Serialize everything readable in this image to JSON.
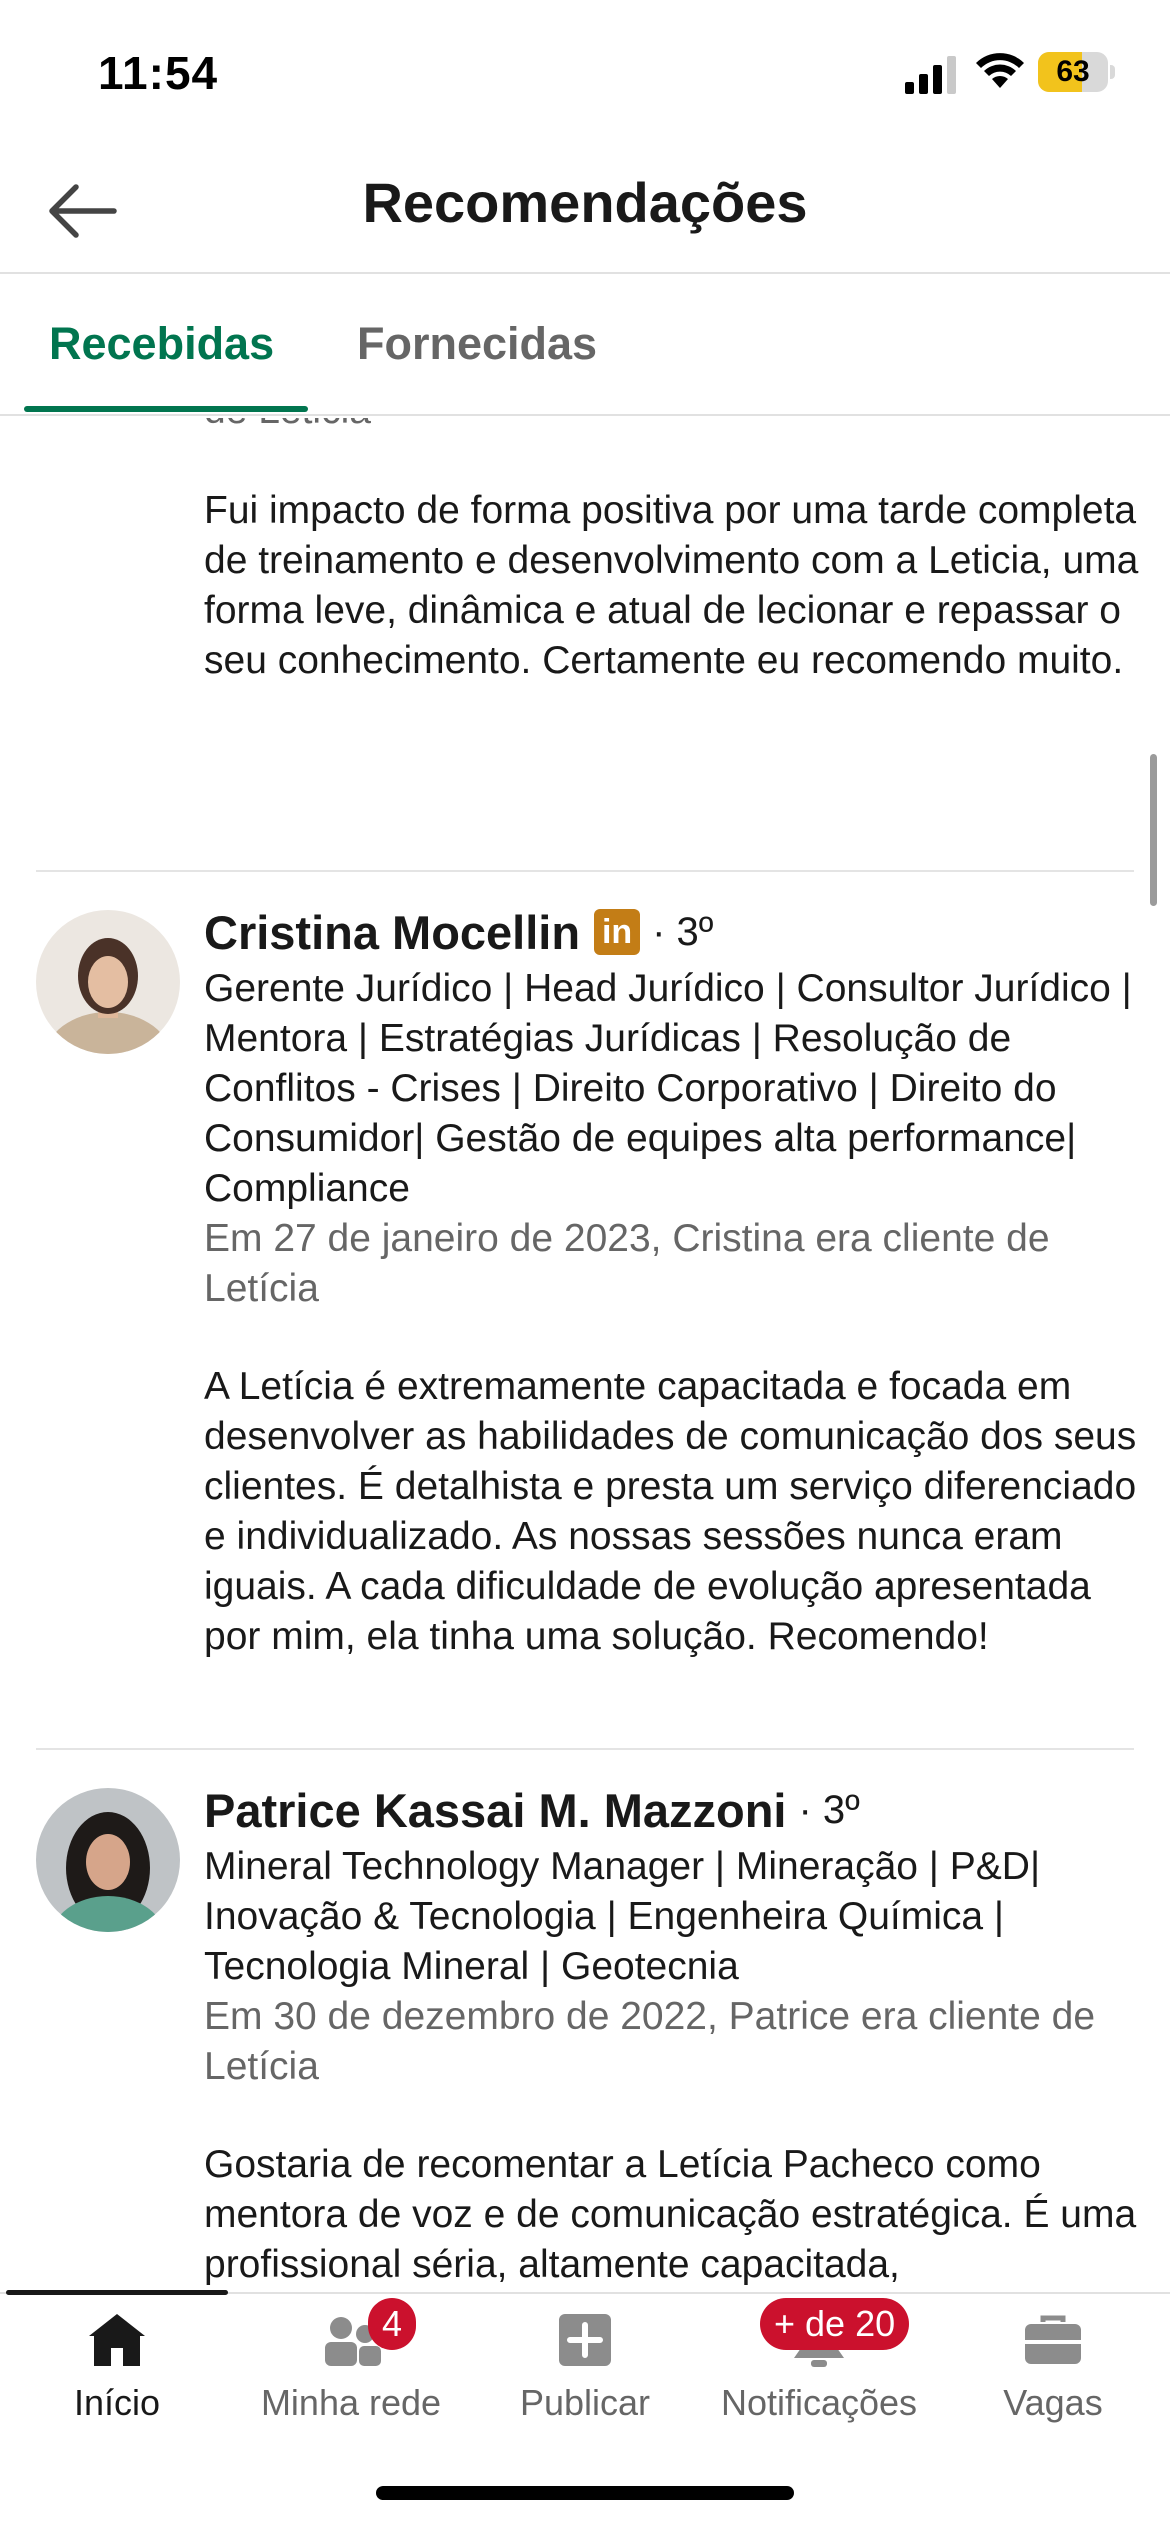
{
  "status_bar": {
    "time": "11:54",
    "battery": "63",
    "battery_level": 0.63,
    "battery_color": "#f2c31c"
  },
  "header": {
    "title": "Recomendações",
    "back_icon": "arrow-left-icon"
  },
  "tabs": [
    {
      "label": "Recebidas",
      "active": true
    },
    {
      "label": "Fornecidas",
      "active": false
    }
  ],
  "recommendations": [
    {
      "meta_tail": "de Leticia",
      "text": "Fui impacto de forma positiva por uma tarde completa de treinamento e desenvolvimento com a Leticia, uma forma leve, dinâmica e atual de lecionar e repassar o seu conhecimento. Certamente eu recomendo muito."
    },
    {
      "name": "Cristina Mocellin",
      "badge": "in",
      "degree": "· 3º",
      "headline": "Gerente Jurídico | Head Jurídico | Consultor Jurídico | Mentora | Estratégias Jurídicas | Resolução de Conflitos - Crises | Direito Corporativo | Direito do Consumidor| Gestão de equipes alta performance| Compliance",
      "meta": "Em 27 de janeiro de 2023, Cristina era cliente de Letícia",
      "text": "A Letícia é extremamente capacitada e focada em desenvolver as habilidades de comunicação dos seus clientes. É detalhista e presta um serviço diferenciado e individualizado. As nossas sessões nunca eram iguais. A cada dificuldade de evolução apresentada por mim, ela tinha uma solução. Recomendo!"
    },
    {
      "name": "Patrice Kassai M. Mazzoni",
      "degree": "· 3º",
      "headline": "Mineral Technology Manager | Mineração | P&D| Inovação & Tecnologia | Engenheira Química | Tecnologia Mineral | Geotecnia",
      "meta": "Em 30 de dezembro de 2022, Patrice era cliente de Letícia",
      "text": "Gostaria de recomentar a Letícia Pacheco como mentora de voz e de comunicação estratégica. É uma profissional séria, altamente capacitada,"
    }
  ],
  "bottom_nav": [
    {
      "label": "Início",
      "icon": "home-icon",
      "active": true
    },
    {
      "label": "Minha rede",
      "icon": "network-icon",
      "badge": "4"
    },
    {
      "label": "Publicar",
      "icon": "plus-square-icon"
    },
    {
      "label": "Notificações",
      "icon": "bell-icon",
      "badge": "+ de 20"
    },
    {
      "label": "Vagas",
      "icon": "briefcase-icon"
    }
  ],
  "colors": {
    "accent": "#01754f",
    "badge": "#cb112d",
    "linkedin_badge": "#c37d16"
  }
}
